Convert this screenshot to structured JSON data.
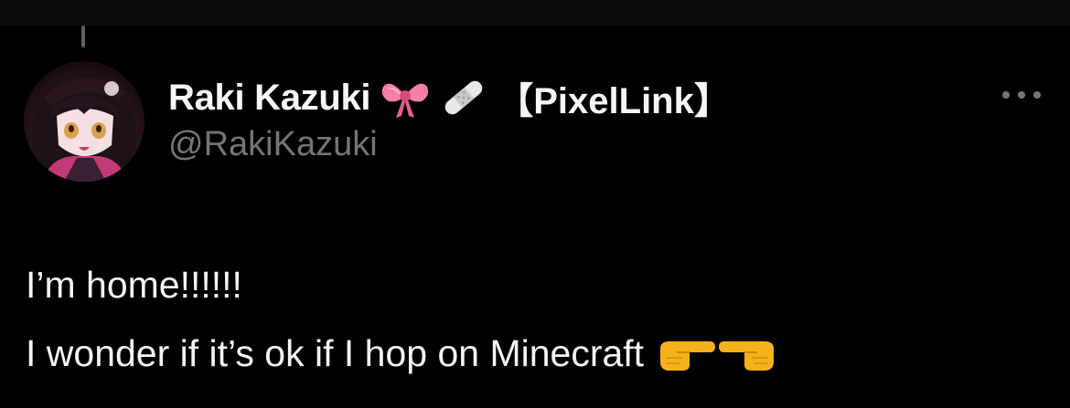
{
  "tweet": {
    "author": {
      "display_name": "Raki Kazuki",
      "name_emojis": [
        "ribbon-icon",
        "bandage-icon"
      ],
      "name_suffix": "【PixelLink】",
      "handle": "@RakiKazuki"
    },
    "text_lines": [
      "I’m home!!!!!!",
      "I wonder if it’s ok if I hop on Minecraft"
    ],
    "text_emojis": [
      "pointing-right-hand-icon",
      "pointing-left-hand-icon"
    ]
  },
  "colors": {
    "background": "#000000",
    "primary_text": "#e7e9ea",
    "secondary_text": "#71767b"
  }
}
